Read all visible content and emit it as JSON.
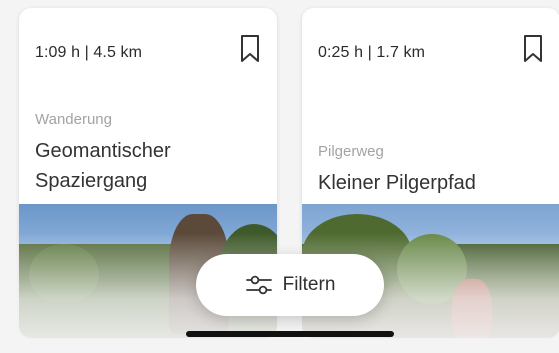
{
  "cards": [
    {
      "meta": "1:09 h | 4.5 km",
      "category": "Wanderung",
      "title_line1": "Geomantischer",
      "title_line2": "Spaziergang"
    },
    {
      "meta": "0:25 h | 1.7 km",
      "category": "Pilgerweg",
      "title_line1": "Kleiner Pilgerpfad",
      "title_line2": ""
    }
  ],
  "filter_button": {
    "label": "Filtern",
    "icon": "sliders-icon"
  },
  "icons": {
    "bookmark": "bookmark-icon"
  },
  "colors": {
    "background": "#f4f4f4",
    "card": "#ffffff",
    "category_text": "#a3a3a3",
    "title_text": "#333333"
  }
}
